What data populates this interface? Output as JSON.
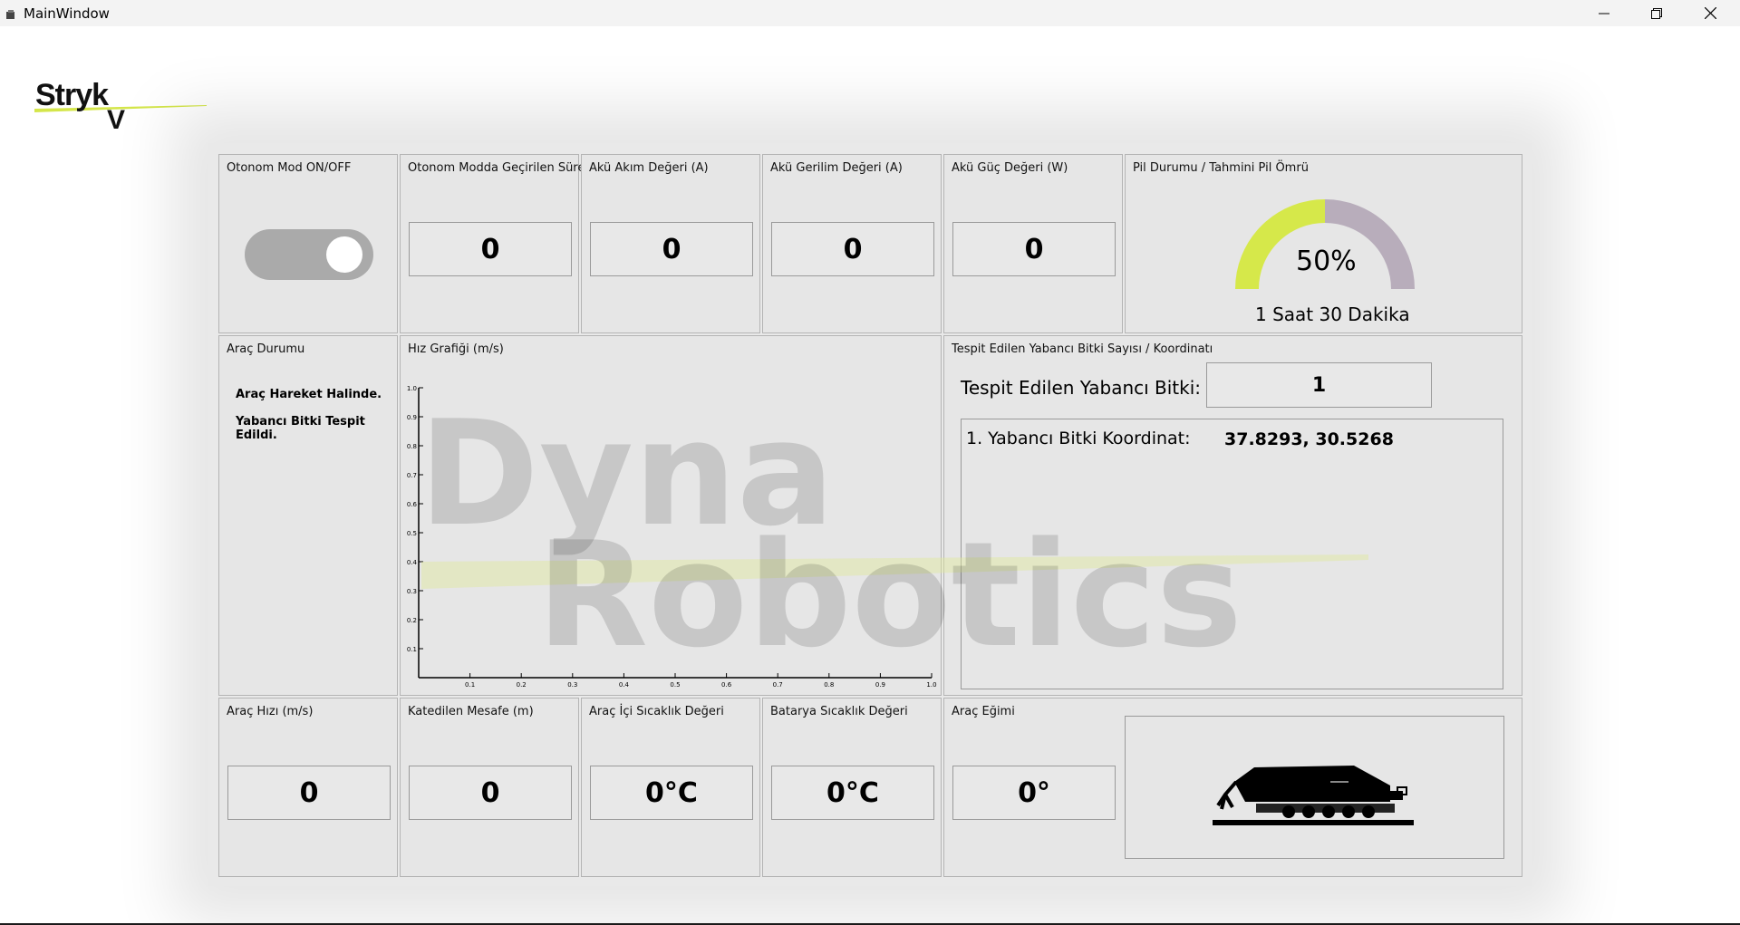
{
  "window": {
    "title": "MainWindow"
  },
  "logo": {
    "text": "StrykV",
    "accent_color": "#d4e64a"
  },
  "top_row": {
    "autonomous_toggle": {
      "label": "Otonom Mod ON/OFF",
      "state": "on"
    },
    "autonomous_time": {
      "label": "Otonom Modda Geçirilen Süre",
      "value": "0"
    },
    "battery_current": {
      "label": "Akü Akım Değeri (A)",
      "value": "0"
    },
    "battery_voltage": {
      "label": "Akü Gerilim Değeri (A)",
      "value": "0"
    },
    "battery_power": {
      "label": "Akü Güç Değeri (W)",
      "value": "0"
    },
    "battery_status": {
      "label": "Pil Durumu / Tahmini Pil Ömrü",
      "percent_text": "50%",
      "percent": 50,
      "remaining": "1 Saat 30 Dakika",
      "fill_color": "#d6e84a",
      "rest_color": "#b8adbb"
    }
  },
  "middle_row": {
    "vehicle_status": {
      "label": "Araç Durumu",
      "lines": [
        "Araç Hareket Halinde.",
        "Yabancı Bitki Tespit Edildi."
      ]
    },
    "speed_chart": {
      "label": "Hız Grafiği (m/s)"
    },
    "weeds": {
      "label": "Tespit Edilen Yabancı Bitki Sayısı / Koordinatı",
      "count_label": "Tespit Edilen Yabancı Bitki:",
      "count": "1",
      "entries": [
        {
          "label": "1. Yabancı Bitki Koordinat:",
          "coords": "37.8293, 30.5268"
        }
      ]
    }
  },
  "bottom_row": {
    "vehicle_speed": {
      "label": "Araç Hızı (m/s)",
      "value": "0"
    },
    "distance": {
      "label": "Katedilen Mesafe (m)",
      "value": "0"
    },
    "cabin_temp": {
      "label": "Araç İçi Sıcaklık Değeri",
      "value": "0°C"
    },
    "battery_temp": {
      "label": "Batarya Sıcaklık Değeri",
      "value": "0°C"
    },
    "tilt": {
      "label": "Araç Eğimi",
      "value": "0°"
    }
  },
  "watermark": {
    "line1": "Dyna",
    "line2": "Robotics"
  },
  "chart_data": {
    "type": "line",
    "title": "",
    "xlabel": "",
    "ylabel": "",
    "xlim": [
      0,
      1.0
    ],
    "ylim": [
      0,
      1.0
    ],
    "xticks": [
      "0.1",
      "0.2",
      "0.3",
      "0.4",
      "0.5",
      "0.6",
      "0.7",
      "0.8",
      "0.9",
      "1.0"
    ],
    "yticks": [
      "0.1",
      "0.2",
      "0.3",
      "0.4",
      "0.5",
      "0.6",
      "0.7",
      "0.8",
      "0.9",
      "1.0"
    ],
    "series": []
  }
}
